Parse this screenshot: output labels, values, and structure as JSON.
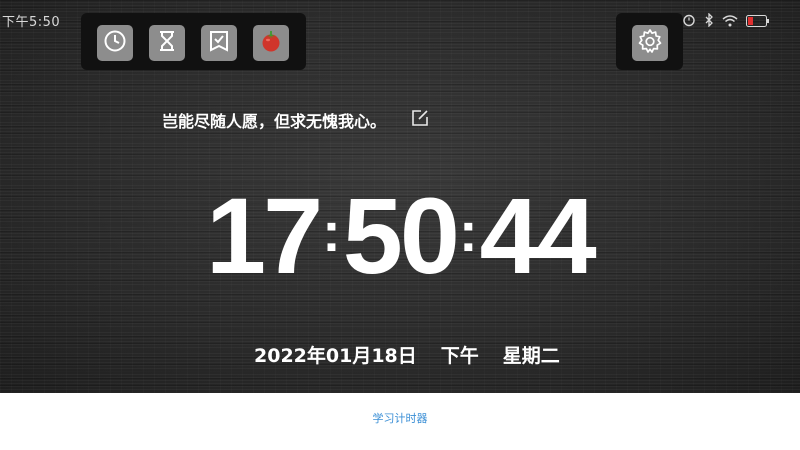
{
  "status_bar": {
    "time": "下午5:50"
  },
  "toolbar": {
    "buttons": [
      {
        "icon": "clock-icon"
      },
      {
        "icon": "hourglass-icon"
      },
      {
        "icon": "checklist-icon"
      },
      {
        "icon": "tomato-icon"
      }
    ],
    "settings_icon": "gear-icon"
  },
  "quote": {
    "text": "岂能尽随人愿，但求无愧我心。"
  },
  "clock": {
    "hours": "17",
    "minutes": "50",
    "seconds": "44",
    "separator": ":"
  },
  "date": {
    "full_date": "2022年01月18日",
    "period": "下午",
    "weekday": "星期二"
  },
  "footer": {
    "label": "学习计时器"
  },
  "colors": {
    "background": "#2b2b2b",
    "toolbar_bg": "#111111",
    "button_bg": "#8d8d8d",
    "text": "#ffffff",
    "footer_link": "#3b8fd6",
    "tomato_red": "#d0352b",
    "tomato_leaf": "#3f9a2e"
  }
}
